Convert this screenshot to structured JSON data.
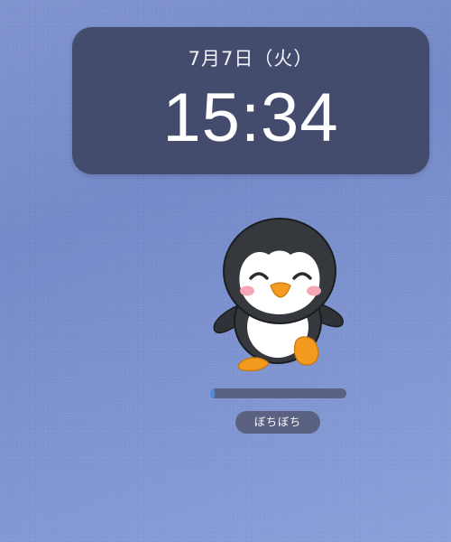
{
  "clock": {
    "date": "7月7日（火）",
    "time": "15:34"
  },
  "mascot": {
    "icon": "penguin-mascot-icon"
  },
  "progress": {
    "fraction": 0.03,
    "color": "#4a8be0"
  },
  "status": {
    "label": "ぼちぼち"
  },
  "colors": {
    "widget_bg": "#3c4260",
    "track": "#5b6281",
    "accent": "#4a8be0"
  }
}
